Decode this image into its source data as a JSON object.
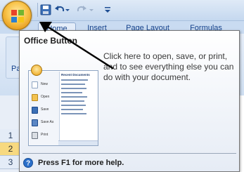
{
  "ribbon": {
    "tabs": [
      {
        "label": "Home"
      },
      {
        "label": "Insert"
      },
      {
        "label": "Page Layout"
      },
      {
        "label": "Formulas"
      }
    ],
    "paste_label": "Pa"
  },
  "grid": {
    "rows": [
      "1",
      "2",
      "3"
    ]
  },
  "tooltip": {
    "title": "Office Button",
    "description": "Click here to open, save, or print, and to see everything else you can do with your document.",
    "help_text": "Press F1 for more help."
  },
  "preview": {
    "menu_items": [
      "New",
      "Open",
      "Save",
      "Save As",
      "Print"
    ],
    "list_header": "Recent Documents"
  },
  "colors": {
    "accent": "#15428b",
    "office_orange": "#f9c54d",
    "arrow": "#000000"
  }
}
